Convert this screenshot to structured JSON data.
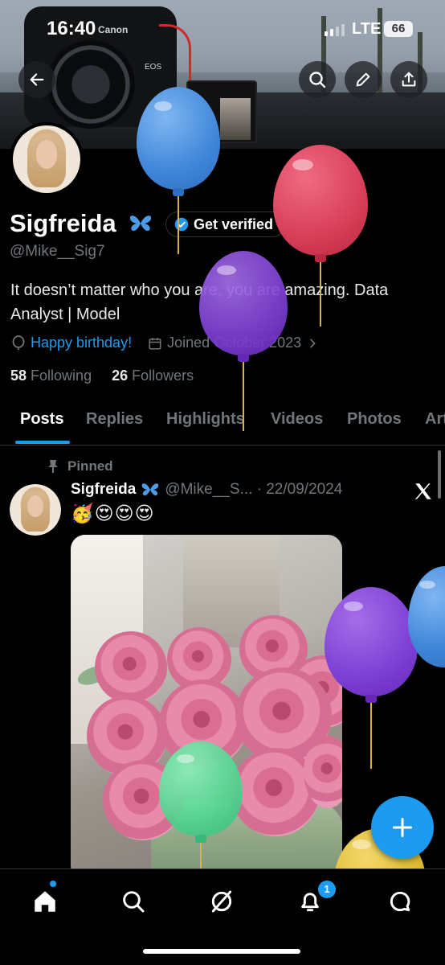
{
  "status_bar": {
    "time": "16:40",
    "network": "LTE",
    "battery": "66"
  },
  "banner": {
    "camera_brand": "Canon",
    "camera_model": "EOS"
  },
  "header": {
    "back": "back-arrow-icon",
    "search": "search-icon",
    "edit": "pencil-icon",
    "share": "share-icon"
  },
  "profile": {
    "name": "Sigfreida",
    "verify_label": "Get verified",
    "handle": "@Mike__Sig7",
    "bio": "It doesn’t matter who you are, you are amazing. Data Analyst | Model",
    "birthday": "Happy birthday!",
    "joined": "Joined October 2023",
    "following_count": "58",
    "following_label": "Following",
    "followers_count": "26",
    "followers_label": "Followers"
  },
  "tabs": [
    {
      "label": "Posts",
      "active": true
    },
    {
      "label": "Replies"
    },
    {
      "label": "Highlights"
    },
    {
      "label": "Videos"
    },
    {
      "label": "Photos"
    },
    {
      "label": "Art"
    }
  ],
  "post": {
    "pinned_label": "Pinned",
    "author_name": "Sigfreida",
    "meta": "@Mike__S... · 22/09/2024",
    "emojis": "🥳😍😍😍",
    "source_icon": "x-logo-icon"
  },
  "nav": {
    "notifications_badge": "1"
  },
  "colors": {
    "accent": "#1d9bf0",
    "background": "#000000",
    "muted": "#71767b"
  }
}
